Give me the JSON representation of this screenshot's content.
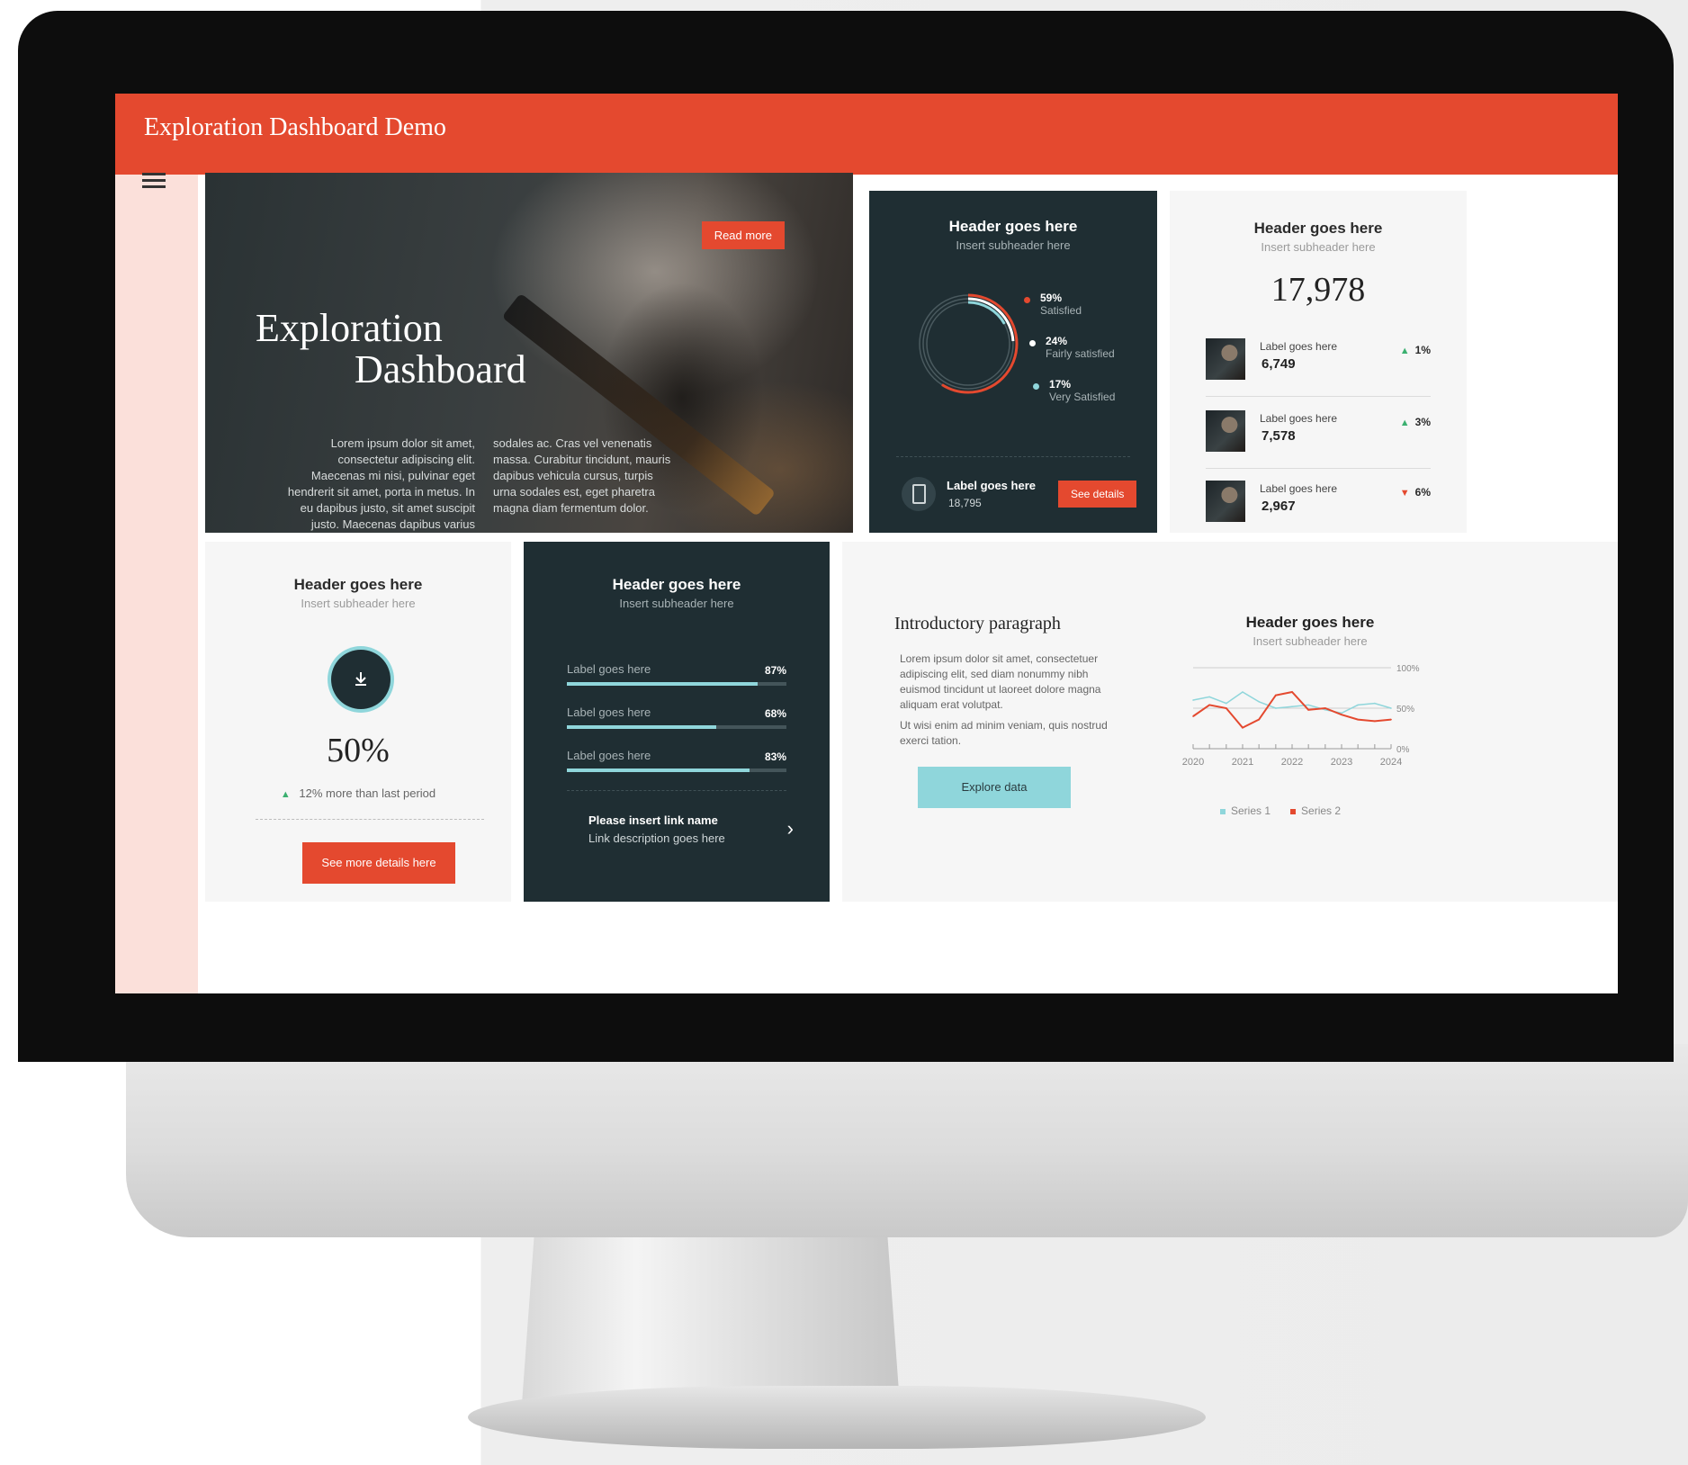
{
  "app": {
    "title": "Exploration Dashboard Demo"
  },
  "colors": {
    "accent": "#e4492f",
    "dark": "#1f2e33",
    "teal": "#8fd6db",
    "rail": "#fbe0da"
  },
  "hero": {
    "read_more": "Read more",
    "title_line1": "Exploration",
    "title_line2": "Dashboard",
    "body_col1": "Lorem ipsum dolor sit amet, consectetur adipiscing elit. Maecenas mi nisi, pulvinar eget hendrerit sit amet, porta in metus. In eu dapibus justo, sit amet suscipit justo. Maecenas dapibus varius lorem, vel commodo sapien",
    "body_col2": "sodales ac. Cras vel venenatis massa. Curabitur tincidunt, mauris dapibus vehicula cursus, turpis urna sodales est, eget pharetra magna diam fermentum dolor."
  },
  "donut_card": {
    "header": "Header goes here",
    "subheader": "Insert subheader here",
    "legend": [
      {
        "pct": "59%",
        "label": "Satisfied",
        "color": "#e4492f"
      },
      {
        "pct": "24%",
        "label": "Fairly satisfied",
        "color": "#ffffff"
      },
      {
        "pct": "17%",
        "label": "Very Satisfied",
        "color": "#8fd6db"
      }
    ],
    "footer_label": "Label goes here",
    "footer_value": "18,795",
    "button": "See details",
    "icon": "phone-icon"
  },
  "stats_card": {
    "header": "Header goes here",
    "subheader": "Insert subheader here",
    "total": "17,978",
    "rows": [
      {
        "label": "Label goes here",
        "value": "6,749",
        "change": "1%",
        "direction": "up"
      },
      {
        "label": "Label goes here",
        "value": "7,578",
        "change": "3%",
        "direction": "up"
      },
      {
        "label": "Label goes here",
        "value": "2,967",
        "change": "6%",
        "direction": "down"
      }
    ]
  },
  "progress_card": {
    "header": "Header goes here",
    "subheader": "Insert subheader here",
    "icon": "download-icon",
    "percent": "50%",
    "note": "12% more than last period",
    "button": "See more details here"
  },
  "bars_card": {
    "header": "Header goes here",
    "subheader": "Insert subheader here",
    "bars": [
      {
        "label": "Label goes here",
        "pct": "87%",
        "value": 0.87
      },
      {
        "label": "Label goes here",
        "pct": "68%",
        "value": 0.68
      },
      {
        "label": "Label goes here",
        "pct": "83%",
        "value": 0.83
      }
    ],
    "link_name": "Please insert link name",
    "link_desc": "Link description goes here"
  },
  "intro_card": {
    "title": "Introductory paragraph",
    "p1": "Lorem ipsum dolor sit amet, consectetuer adipiscing elit, sed diam nonummy nibh euismod tincidunt ut laoreet dolore magna aliquam erat volutpat.",
    "p2": "Ut wisi enim ad minim veniam, quis nostrud exerci tation.",
    "button": "Explore data",
    "chart_header": "Header goes here",
    "chart_subheader": "Insert subheader here"
  },
  "chart_data": {
    "type": "line",
    "x": [
      2020,
      2020.33,
      2020.67,
      2021,
      2021.33,
      2021.67,
      2022,
      2022.33,
      2022.67,
      2023,
      2023.33,
      2023.67,
      2024
    ],
    "x_tick_labels": [
      "2020",
      "2021",
      "2022",
      "2023",
      "2024"
    ],
    "y_tick_labels": [
      "100%",
      "50%",
      "0%"
    ],
    "ylim": [
      0,
      100
    ],
    "series": [
      {
        "name": "Series 1",
        "color": "#8fd6db",
        "values": [
          60,
          64,
          56,
          70,
          58,
          50,
          52,
          54,
          48,
          44,
          54,
          56,
          50
        ]
      },
      {
        "name": "Series 2",
        "color": "#e4492f",
        "values": [
          40,
          54,
          50,
          26,
          36,
          66,
          70,
          48,
          50,
          42,
          36,
          34,
          36
        ]
      }
    ],
    "grid": "horizontal",
    "legend": "bottom"
  }
}
